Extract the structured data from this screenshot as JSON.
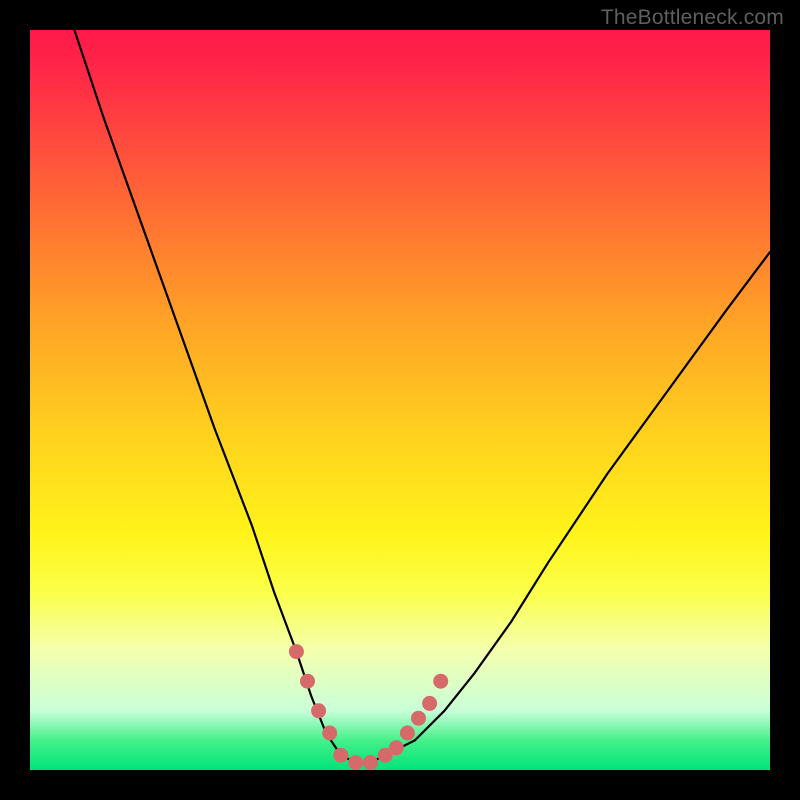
{
  "watermark": "TheBottleneck.com",
  "chart_data": {
    "type": "line",
    "title": "",
    "xlabel": "",
    "ylabel": "",
    "xlim": [
      0,
      100
    ],
    "ylim": [
      0,
      100
    ],
    "series": [
      {
        "name": "bottleneck-curve",
        "x": [
          6,
          10,
          15,
          20,
          25,
          30,
          33,
          36,
          38,
          40,
          42,
          44,
          46,
          48,
          52,
          56,
          60,
          65,
          70,
          78,
          86,
          94,
          100
        ],
        "values": [
          100,
          88,
          74,
          60,
          46,
          33,
          24,
          16,
          10,
          5,
          2,
          1,
          1,
          2,
          4,
          8,
          13,
          20,
          28,
          40,
          51,
          62,
          70
        ]
      }
    ],
    "annotations": [
      {
        "name": "valley-highlight",
        "type": "marker-run",
        "color": "#d66a6a",
        "x": [
          36,
          37.5,
          39,
          40.5,
          42,
          44,
          46,
          48,
          49.5,
          51,
          52.5,
          54,
          55.5
        ],
        "values": [
          16,
          12,
          8,
          5,
          2,
          1,
          1,
          2,
          3,
          5,
          7,
          9,
          12
        ]
      }
    ],
    "background_gradient": {
      "from": "#ff1a4a",
      "to": "#00e47a"
    }
  }
}
